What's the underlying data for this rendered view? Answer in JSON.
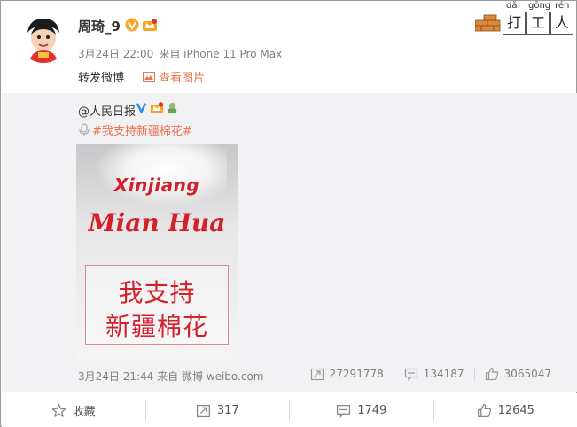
{
  "post": {
    "username": "周琦_9",
    "meta": {
      "time": "3月24日 22:00",
      "source": "来自 iPhone 11 Pro Max"
    },
    "text": "转发微博",
    "view_pic_label": "查看图片"
  },
  "top_right": {
    "pinyin": [
      "dǎ",
      "gōng",
      "rén"
    ],
    "chars": [
      "打",
      "工",
      "人"
    ]
  },
  "original": {
    "author": "@人民日报",
    "hashtag": "#我支持新疆棉花#",
    "poster": {
      "line1": "Xinjiang",
      "line2": "Mian Hua",
      "cn_line1": "我支持",
      "cn_line2": "新疆棉花"
    },
    "meta": {
      "time": "3月24日 21:44",
      "source": "来自 微博 weibo.com"
    },
    "stats": {
      "reposts": "27291778",
      "comments": "134187",
      "likes": "3065047"
    }
  },
  "actions": {
    "favorite": "收藏",
    "repost": "317",
    "comment": "1749",
    "like": "12645"
  },
  "colors": {
    "accent": "#eb7350",
    "poster_red": "#d3202a",
    "repost_bg": "#f2f2f5",
    "verified_gold": "#f5a623"
  }
}
